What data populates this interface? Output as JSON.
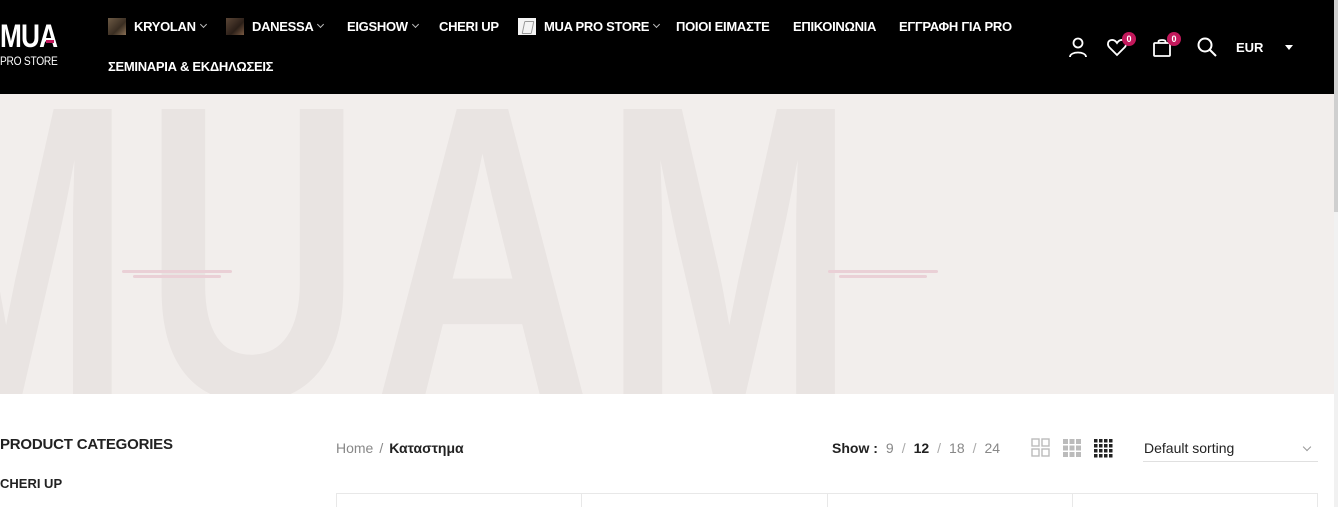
{
  "logo": {
    "main": "MUA",
    "sub": "PRO STORE"
  },
  "nav": {
    "row1": [
      {
        "label": "KRYOLAN",
        "thumb": "kryolan",
        "dropdown": true
      },
      {
        "label": "DANESSA",
        "thumb": "danessa",
        "dropdown": true
      },
      {
        "label": "EIGSHOW",
        "thumb": "",
        "dropdown": true
      },
      {
        "label": "CHERI UP",
        "thumb": "",
        "dropdown": false
      },
      {
        "label": "MUA PRO STORE",
        "thumb": "mua",
        "dropdown": true
      },
      {
        "label": "ΠΟΙΟΙ ΕΙΜΑΣΤΕ",
        "thumb": "",
        "dropdown": false
      },
      {
        "label": "ΕΠΙΚΟΙΝΩΝΙΑ",
        "thumb": "",
        "dropdown": false
      },
      {
        "label": "ΕΓΓΡΑΦΗ ΓΙΑ PRO",
        "thumb": "",
        "dropdown": false
      }
    ],
    "row2": [
      {
        "label": "ΣΕΜΙΝΑΡΙΑ & ΕΚΔΗΛΩΣΕΙΣ"
      }
    ]
  },
  "header_icons": {
    "account": "user-icon",
    "wishlist": "heart-icon",
    "wishlist_count": "0",
    "cart": "shopping-bag-icon",
    "cart_count": "0",
    "search": "search-icon"
  },
  "currency": {
    "selected": "EUR"
  },
  "hero": {
    "watermark": "MUAM"
  },
  "sidebar": {
    "title": "PRODUCT CATEGORIES",
    "items": [
      "CHERI UP"
    ]
  },
  "breadcrumb": {
    "home": "Home",
    "separator": "/",
    "current": "Καταστημα"
  },
  "toolbar": {
    "show_label": "Show :",
    "show_options": [
      "9",
      "12",
      "18",
      "24"
    ],
    "show_selected": "12",
    "sorting": "Default sorting"
  },
  "colors": {
    "header_bg": "#000000",
    "accent": "#c2185b",
    "hero_bg": "#f2eeec"
  }
}
